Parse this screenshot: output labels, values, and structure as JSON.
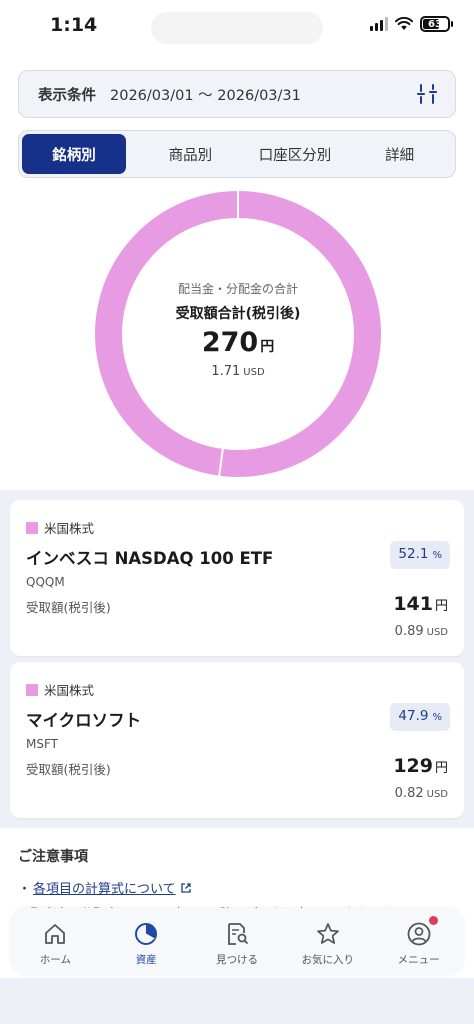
{
  "status_bar": {
    "time": "1:14",
    "battery": "63"
  },
  "filter": {
    "label": "表示条件",
    "range": "2026/03/01 〜 2026/03/31",
    "icon": "sliders-icon"
  },
  "tabs": [
    {
      "label": "銘柄別",
      "active": true
    },
    {
      "label": "商品別",
      "active": false
    },
    {
      "label": "口座区分別",
      "active": false
    },
    {
      "label": "詳細",
      "active": false
    }
  ],
  "summary": {
    "caption": "配当金・分配金の合計",
    "title": "受取額合計(税引後)",
    "amount": "270",
    "amount_unit": "円",
    "usd": "1.71",
    "usd_unit": "USD"
  },
  "chart_data": {
    "type": "pie",
    "title": "",
    "categories": [
      "インベスコ NASDAQ 100 ETF",
      "マイクロソフト"
    ],
    "values": [
      52.1,
      47.9
    ],
    "colors": [
      "#e79be3",
      "#e79be3"
    ]
  },
  "holdings": [
    {
      "category": "米国株式",
      "name": "インベスコ NASDAQ 100 ETF",
      "ticker": "QQQM",
      "received_label": "受取額(税引後)",
      "percent": "52.1",
      "percent_unit": "%",
      "amount": "141",
      "amount_unit": "円",
      "usd": "0.89",
      "usd_unit": "USD"
    },
    {
      "category": "米国株式",
      "name": "マイクロソフト",
      "ticker": "MSFT",
      "received_label": "受取額(税引後)",
      "percent": "47.9",
      "percent_unit": "%",
      "amount": "129",
      "amount_unit": "円",
      "usd": "0.82",
      "usd_unit": "USD"
    }
  ],
  "notes": {
    "title": "ご注意事項",
    "link": "各項目の計算式について",
    "line": "・配当金・分配金は、2021年8月以降のデータを表示しております。"
  },
  "tabbar": [
    {
      "label": "ホーム",
      "icon": "home-icon"
    },
    {
      "label": "資産",
      "icon": "pie-chart-icon"
    },
    {
      "label": "見つける",
      "icon": "search-document-icon"
    },
    {
      "label": "お気に入り",
      "icon": "star-icon"
    },
    {
      "label": "メニュー",
      "icon": "user-icon"
    }
  ],
  "colors": {
    "accent": "#173089",
    "segment": "#e79be3",
    "badge_bg": "#e7ebf5",
    "notification": "#e23b55"
  }
}
